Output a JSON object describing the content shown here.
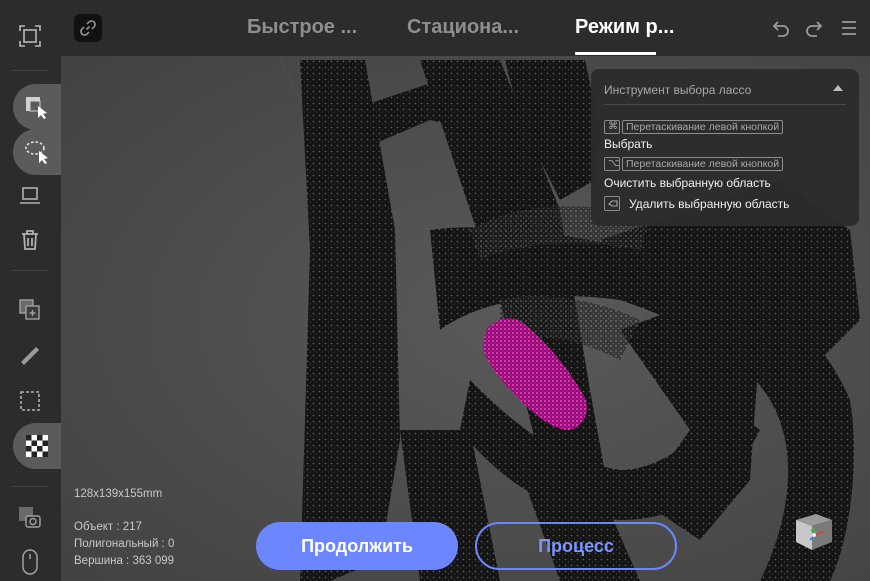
{
  "header": {
    "tabs": [
      {
        "label": "Быстрое ...",
        "active": false
      },
      {
        "label": "Стациона...",
        "active": false
      },
      {
        "label": "Режим р...",
        "active": true
      }
    ],
    "icons": [
      "link-icon",
      "undo-icon",
      "redo-icon",
      "menu-icon"
    ]
  },
  "sidebar": {
    "tools": [
      "fullscreen-icon",
      "select-rect-icon",
      "lasso-select-icon",
      "laptop-icon",
      "trash-icon",
      "add-layer-icon",
      "ruler-icon",
      "crop-icon",
      "checkerboard-icon",
      "photo-camera-icon",
      "mouse-icon"
    ],
    "active_tools": [
      "select-rect-icon",
      "lasso-select-icon",
      "checkerboard-icon"
    ]
  },
  "panel": {
    "title": "Инструмент выбора лассо",
    "rows": [
      {
        "key": "⌘",
        "hint": "Перетаскивание левой кнопкой",
        "action": "Выбрать"
      },
      {
        "key": "⌥",
        "hint": "Перетаскивание левой кнопкой",
        "action": "Очистить выбранную область"
      },
      {
        "key_icon": "eraser-icon",
        "action": "Удалить выбранную область"
      }
    ]
  },
  "stats": {
    "dimensions": "128x139x155mm",
    "object": "Объект : 217",
    "polygonal": "Полигональный : 0",
    "vertices": "Вершина : 363 099"
  },
  "buttons": {
    "continue": "Продолжить",
    "process": "Процесс"
  },
  "colors": {
    "accent": "#6b86ff",
    "selection": "#e020b0",
    "background": "#2c2c2c"
  }
}
